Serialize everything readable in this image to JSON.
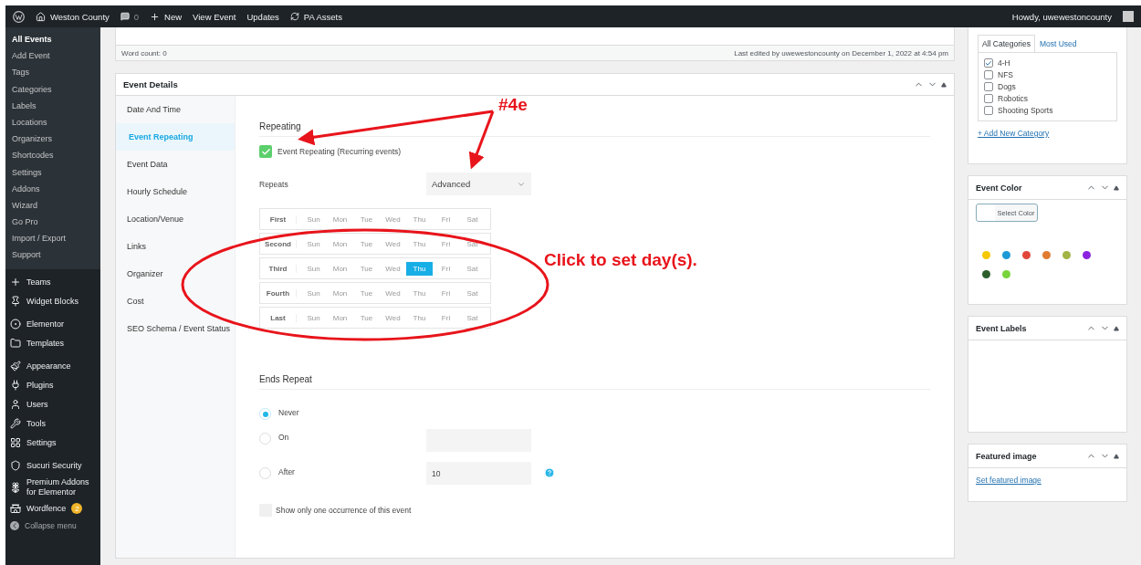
{
  "admin_bar": {
    "site": "Weston County",
    "comments": "0",
    "new": "New",
    "links": [
      "View Event",
      "Updates"
    ],
    "assets": "PA Assets",
    "greeting": "Howdy, uwewestoncounty"
  },
  "sidebar": {
    "submenu": [
      {
        "label": "All Events",
        "selected": true
      },
      {
        "label": "Add Event",
        "selected": false
      },
      {
        "label": "Tags",
        "selected": false
      },
      {
        "label": "Categories",
        "selected": false
      },
      {
        "label": "Labels",
        "selected": false
      },
      {
        "label": "Locations",
        "selected": false
      },
      {
        "label": "Organizers",
        "selected": false
      },
      {
        "label": "Shortcodes",
        "selected": false
      },
      {
        "label": "Settings",
        "selected": false
      },
      {
        "label": "Addons",
        "selected": false
      },
      {
        "label": "Wizard",
        "selected": false
      },
      {
        "label": "Go Pro",
        "selected": false
      },
      {
        "label": "Import / Export",
        "selected": false
      },
      {
        "label": "Support",
        "selected": false
      }
    ],
    "menu_groups": [
      [
        {
          "label": "Teams"
        },
        {
          "label": "Widget Blocks"
        }
      ],
      [
        {
          "label": "Elementor"
        },
        {
          "label": "Templates"
        }
      ],
      [
        {
          "label": "Appearance"
        },
        {
          "label": "Plugins"
        },
        {
          "label": "Users"
        },
        {
          "label": "Tools"
        },
        {
          "label": "Settings"
        }
      ],
      [
        {
          "label": "Sucuri Security"
        },
        {
          "label": "Premium Addons for Elementor"
        },
        {
          "label": "Wordfence",
          "badge": "2"
        }
      ]
    ],
    "collapse": "Collapse menu"
  },
  "editor": {
    "word_count": "Word count: 0",
    "last_edited": "Last edited by uwewestoncounty on December 1, 2022 at 4:54 pm"
  },
  "event_details": {
    "title": "Event Details",
    "tabs": [
      {
        "label": "Date And Time",
        "selected": false
      },
      {
        "label": "Event Repeating",
        "selected": true
      },
      {
        "label": "Event Data",
        "selected": false
      },
      {
        "label": "Hourly Schedule",
        "selected": false
      },
      {
        "label": "Location/Venue",
        "selected": false
      },
      {
        "label": "Links",
        "selected": false
      },
      {
        "label": "Organizer",
        "selected": false
      },
      {
        "label": "Cost",
        "selected": false
      },
      {
        "label": "SEO Schema / Event Status",
        "selected": false
      }
    ],
    "section_title": "Repeating",
    "repeat_checkbox": {
      "label": "Event Repeating (Recurring events)",
      "checked": true
    },
    "repeats": {
      "label": "Repeats",
      "value": "Advanced"
    },
    "week_rows": [
      {
        "label": "First",
        "days": [
          {
            "label": "Sun",
            "selected": false
          },
          {
            "label": "Mon",
            "selected": false
          },
          {
            "label": "Tue",
            "selected": false
          },
          {
            "label": "Wed",
            "selected": false
          },
          {
            "label": "Thu",
            "selected": false
          },
          {
            "label": "Fri",
            "selected": false
          },
          {
            "label": "Sat",
            "selected": false
          }
        ]
      },
      {
        "label": "Second",
        "days": [
          {
            "label": "Sun",
            "selected": false
          },
          {
            "label": "Mon",
            "selected": false
          },
          {
            "label": "Tue",
            "selected": false
          },
          {
            "label": "Wed",
            "selected": false
          },
          {
            "label": "Thu",
            "selected": false
          },
          {
            "label": "Fri",
            "selected": false
          },
          {
            "label": "Sat",
            "selected": false
          }
        ]
      },
      {
        "label": "Third",
        "days": [
          {
            "label": "Sun",
            "selected": false
          },
          {
            "label": "Mon",
            "selected": false
          },
          {
            "label": "Tue",
            "selected": false
          },
          {
            "label": "Wed",
            "selected": false
          },
          {
            "label": "Thu",
            "selected": true
          },
          {
            "label": "Fri",
            "selected": false
          },
          {
            "label": "Sat",
            "selected": false
          }
        ]
      },
      {
        "label": "Fourth",
        "days": [
          {
            "label": "Sun",
            "selected": false
          },
          {
            "label": "Mon",
            "selected": false
          },
          {
            "label": "Tue",
            "selected": false
          },
          {
            "label": "Wed",
            "selected": false
          },
          {
            "label": "Thu",
            "selected": false
          },
          {
            "label": "Fri",
            "selected": false
          },
          {
            "label": "Sat",
            "selected": false
          }
        ]
      },
      {
        "label": "Last",
        "days": [
          {
            "label": "Sun",
            "selected": false
          },
          {
            "label": "Mon",
            "selected": false
          },
          {
            "label": "Tue",
            "selected": false
          },
          {
            "label": "Wed",
            "selected": false
          },
          {
            "label": "Thu",
            "selected": false
          },
          {
            "label": "Fri",
            "selected": false
          },
          {
            "label": "Sat",
            "selected": false
          }
        ]
      }
    ],
    "ends_title": "Ends Repeat",
    "ends_options": [
      {
        "label": "Never",
        "selected": true,
        "kind": "plain"
      },
      {
        "label": "On",
        "selected": false,
        "kind": "date"
      },
      {
        "label": "After",
        "selected": false,
        "kind": "count",
        "value": "10"
      }
    ],
    "one_occurrence": {
      "label": "Show only one occurrence of this event",
      "checked": false
    }
  },
  "categories": {
    "tabs": [
      {
        "label": "All Categories",
        "selected": true
      },
      {
        "label": "Most Used",
        "selected": false
      }
    ],
    "items": [
      {
        "label": "4-H",
        "checked": true
      },
      {
        "label": "NFS",
        "checked": false
      },
      {
        "label": "Dogs",
        "checked": false
      },
      {
        "label": "Robotics",
        "checked": false
      },
      {
        "label": "Shooting Sports",
        "checked": false
      }
    ],
    "add_link": "+ Add New Category"
  },
  "event_color": {
    "title": "Event Color",
    "button": "Select Color",
    "swatches": [
      {
        "color": "#f5c800"
      },
      {
        "color": "#1b9ad6"
      },
      {
        "color": "#e0473a"
      },
      {
        "color": "#e07b30"
      },
      {
        "color": "#a2b444"
      },
      {
        "color": "#8a22e0"
      },
      {
        "color": "#2c5e2c"
      },
      {
        "color": "#79d33a"
      }
    ]
  },
  "event_labels": {
    "title": "Event Labels"
  },
  "featured_image": {
    "title": "Featured image",
    "link": "Set featured image"
  },
  "annotations": [
    {
      "text": "#4e"
    },
    {
      "text": "Click to set day(s)."
    }
  ]
}
